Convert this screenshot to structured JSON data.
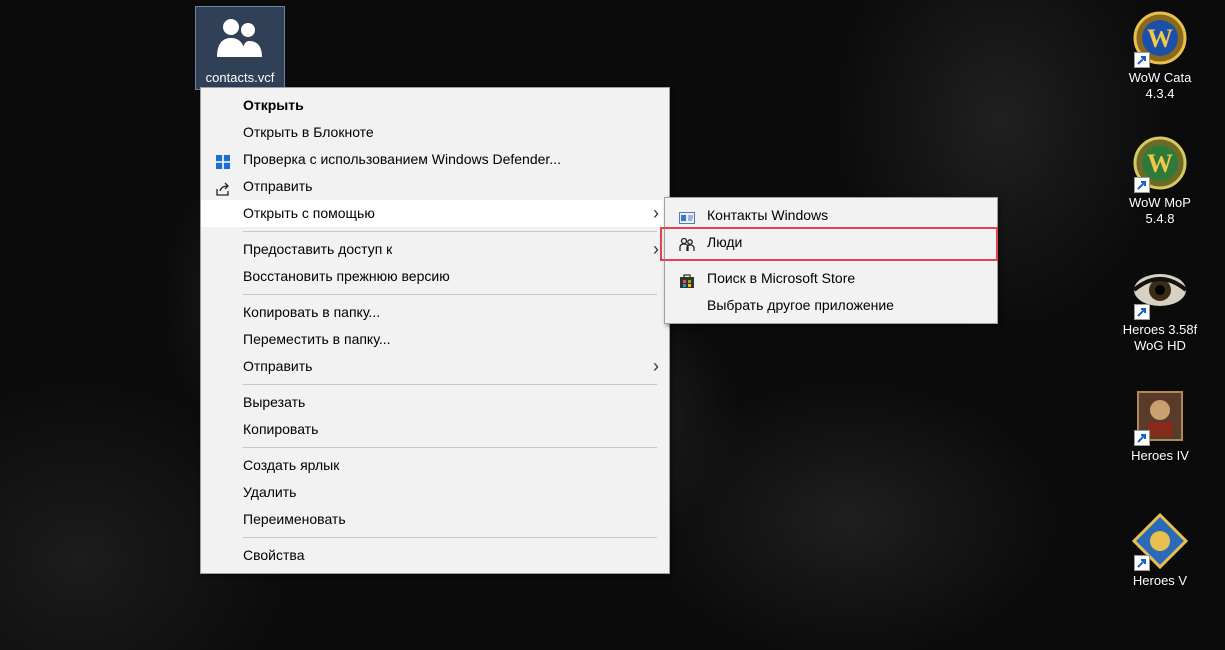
{
  "file": {
    "label": "contacts.vcf",
    "icon": "contacts-icon"
  },
  "desktop_icons": [
    {
      "label1": "WoW Cata",
      "label2": "4.3.4",
      "icon": "wow-icon"
    },
    {
      "label1": "WoW MoP",
      "label2": "5.4.8",
      "icon": "wow-icon"
    },
    {
      "label1": "Heroes 3.58f",
      "label2": "WoG HD",
      "icon": "eye-icon"
    },
    {
      "label1": "Heroes IV",
      "label2": "",
      "icon": "heroes4-icon"
    },
    {
      "label1": "Heroes V",
      "label2": "",
      "icon": "heroes5-icon"
    }
  ],
  "context_menu": {
    "open": "Открыть",
    "open_notepad": "Открыть в Блокноте",
    "defender": "Проверка с использованием Windows Defender...",
    "share": "Отправить",
    "open_with": "Открыть с помощью",
    "give_access": "Предоставить доступ к",
    "restore": "Восстановить прежнюю версию",
    "copy_to": "Копировать в папку...",
    "move_to": "Переместить в папку...",
    "send_to": "Отправить",
    "cut": "Вырезать",
    "copy": "Копировать",
    "create_shortcut": "Создать ярлык",
    "delete": "Удалить",
    "rename": "Переименовать",
    "properties": "Свойства"
  },
  "submenu": {
    "windows_contacts": "Контакты Windows",
    "people": "Люди",
    "store_search": "Поиск в Microsoft Store",
    "choose_other": "Выбрать другое приложение"
  },
  "colors": {
    "menu_bg": "#f2f2f2",
    "highlight": "#e0444c",
    "hover": "#ffffff"
  }
}
